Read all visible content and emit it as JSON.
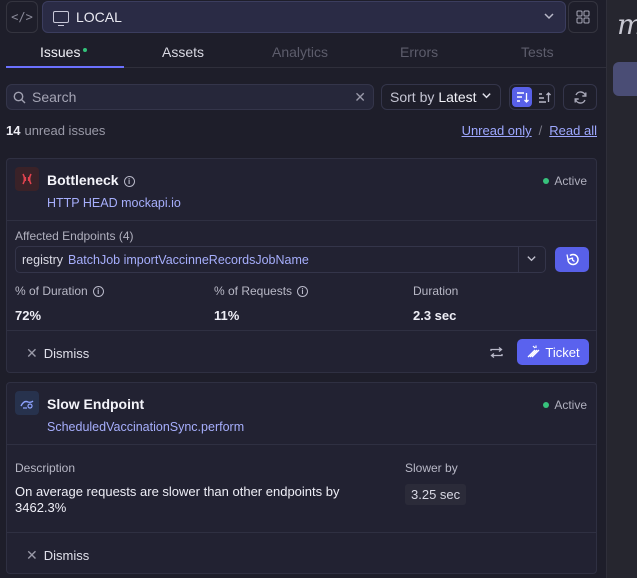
{
  "environment": {
    "label": "LOCAL"
  },
  "tabs": [
    {
      "label": "Issues",
      "has_indicator": true
    },
    {
      "label": "Assets"
    },
    {
      "label": "Analytics"
    },
    {
      "label": "Errors"
    },
    {
      "label": "Tests"
    }
  ],
  "search": {
    "placeholder": "Search",
    "value": ""
  },
  "sort": {
    "prefix": "Sort by",
    "value": "Latest"
  },
  "summary": {
    "count": "14",
    "text": "unread issues",
    "unread_only": "Unread only",
    "separator": "/",
    "read_all": "Read all"
  },
  "issues": [
    {
      "title": "Bottleneck",
      "subtitle": "HTTP HEAD mockapi.io",
      "status": "Active",
      "affected_label": "Affected Endpoints (4)",
      "endpoint_verb": "registry",
      "endpoint_path": "BatchJob importVaccinneRecordsJobName",
      "metrics": [
        {
          "label": "% of Duration",
          "value": "72%"
        },
        {
          "label": "% of Requests",
          "value": "11%"
        },
        {
          "label": "Duration",
          "value": "2.3 sec"
        }
      ],
      "dismiss": "Dismiss",
      "ticket": "Ticket"
    },
    {
      "title": "Slow Endpoint",
      "subtitle": "ScheduledVaccinationSync.perform",
      "status": "Active",
      "description_label": "Description",
      "description": "On average requests are slower than other endpoints by 3462.3%",
      "slower_label": "Slower by",
      "slower_value": "3.25 sec",
      "dismiss": "Dismiss"
    }
  ],
  "side_panel": {
    "letter": "m"
  },
  "colors": {
    "accent": "#5a62ee",
    "active_green": "#37c27c",
    "link": "#9ea8ff",
    "background": "#1e1e2a"
  }
}
